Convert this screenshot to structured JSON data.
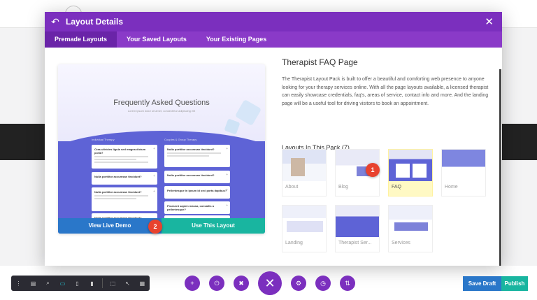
{
  "modal": {
    "title": "Layout Details",
    "tabs": [
      {
        "label": "Premade Layouts"
      },
      {
        "label": "Your Saved Layouts"
      },
      {
        "label": "Your Existing Pages"
      }
    ]
  },
  "preview": {
    "title": "Frequently Asked Questions",
    "subtitle": "Lorem ipsum dolor sit amet, consectetur adipiscing elit",
    "col1_header": "Individual Therapy",
    "col2_header": "Couples & Group Therapy",
    "col1_cards": [
      "Cras ultricies ligula sed magna dictum porta?",
      "Nulla porttitor accumsan tincidunt?",
      "Nulla porttitor accumsan tincidunt?",
      "Nulla porttitor accumsan tincidunt?"
    ],
    "col2_cards": [
      "Nulla porttitor accumsan tincidunt?",
      "Nulla porttitor accumsan tincidunt?",
      "Pellentesque in ipsum id orci porta dapibus?",
      "Praesent sapien massa, convallis a pellentesque?",
      "Nulla porttitor accumsan tincidunt?"
    ],
    "demo_label": "View Live Demo",
    "use_label": "Use This Layout"
  },
  "badges": {
    "one": "1",
    "two": "2"
  },
  "info": {
    "title": "Therapist FAQ Page",
    "description": "The Therapist Layout Pack is built to offer a beautiful and comforting web presence to anyone looking for your therapy services online. With all the page layouts available, a licensed therapist can easily showcase credentials, faq's, areas of service, contact info and more. And the landing page will be a useful tool for driving visitors to book an appointment.",
    "pack_heading": "Layouts In This Pack (7)"
  },
  "layouts": [
    {
      "label": "About"
    },
    {
      "label": "Blog"
    },
    {
      "label": "FAQ"
    },
    {
      "label": "Home"
    },
    {
      "label": "Landing"
    },
    {
      "label": "Therapist Ser..."
    },
    {
      "label": "Services"
    }
  ],
  "toolbar": {
    "save_label": "Save Draft",
    "publish_label": "Publish"
  },
  "colors": {
    "header": "#7b2fbe",
    "tabs": "#8a3ac8",
    "blue": "#2a77c9",
    "teal": "#19b5a0",
    "badge": "#e8422e",
    "selected_thumb": "#fff9c4"
  }
}
